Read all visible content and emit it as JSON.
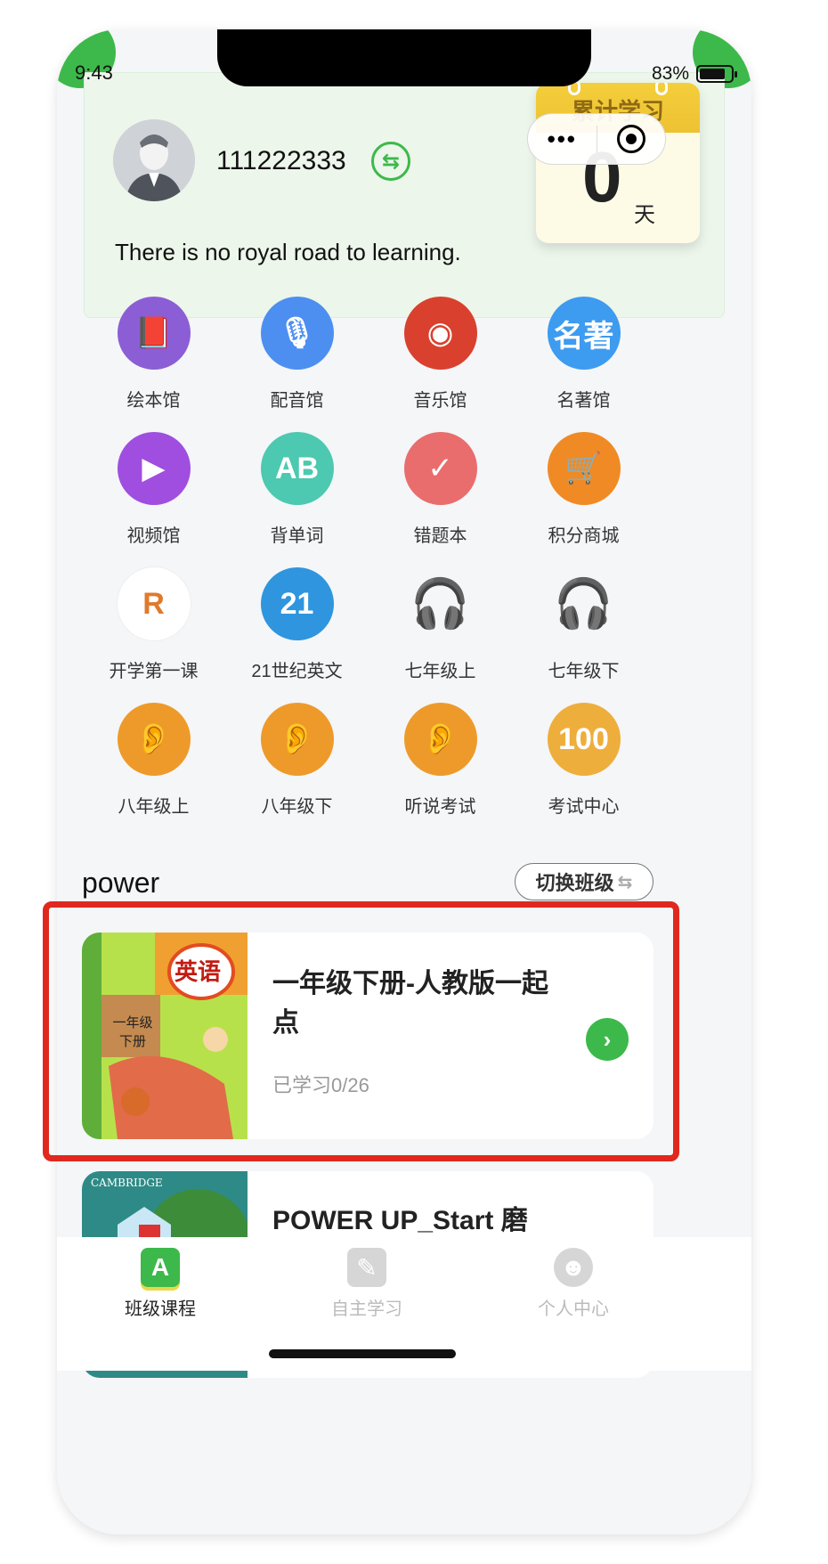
{
  "status_bar": {
    "time": "9:43",
    "battery": "83%",
    "battery_level": 0.83
  },
  "mini_program_capsule": {
    "more_label": "•••"
  },
  "profile": {
    "username": "111222333",
    "switch_icon": "⇆",
    "motto": "There is no royal road to learning."
  },
  "study_calendar": {
    "title": "累计学习",
    "days": "0",
    "unit": "天"
  },
  "features": [
    {
      "label": "绘本馆",
      "icon": "book-icon",
      "color": "#8b5ed6",
      "glyph": "📕"
    },
    {
      "label": "配音馆",
      "icon": "microphone-icon",
      "color": "#4d8ff0",
      "glyph": "🎙"
    },
    {
      "label": "音乐馆",
      "icon": "music-disc-icon",
      "color": "#d9412e",
      "glyph": "◉"
    },
    {
      "label": "名著馆",
      "icon": "classics-book-icon",
      "color": "#3d9bf0",
      "glyph": "名著"
    },
    {
      "label": "视频馆",
      "icon": "video-camera-icon",
      "color": "#a04ee0",
      "glyph": "▶"
    },
    {
      "label": "背单词",
      "icon": "abcd-icon",
      "color": "#4cc9b0",
      "glyph": "AB"
    },
    {
      "label": "错题本",
      "icon": "notebook-check-icon",
      "color": "#e96d6d",
      "glyph": "✓"
    },
    {
      "label": "积分商城",
      "icon": "shopping-cart-icon",
      "color": "#f08a24",
      "glyph": "🛒"
    },
    {
      "label": "开学第一课",
      "icon": "r-logo-icon",
      "color": "#ffffff",
      "glyph": "R"
    },
    {
      "label": "21世纪英文",
      "icon": "21-century-icon",
      "color": "#2f95de",
      "glyph": "21"
    },
    {
      "label": "七年级上",
      "icon": "headphones-icon",
      "color": "transparent",
      "glyph": "🎧"
    },
    {
      "label": "七年级下",
      "icon": "headphones-icon",
      "color": "transparent",
      "glyph": "🎧"
    },
    {
      "label": "八年级上",
      "icon": "speaking-head-icon",
      "color": "#ee9a2a",
      "glyph": "👂"
    },
    {
      "label": "八年级下",
      "icon": "speaking-head-icon",
      "color": "#ee9a2a",
      "glyph": "👂"
    },
    {
      "label": "听说考试",
      "icon": "speaking-head-icon",
      "color": "#ee9a2a",
      "glyph": "👂"
    },
    {
      "label": "考试中心",
      "icon": "exam-center-icon",
      "color": "#eeae3c",
      "glyph": "100"
    }
  ],
  "class_section": {
    "title": "power",
    "switch_label": "切换班级",
    "switch_icon": "⇆"
  },
  "courses": [
    {
      "title": "一年级下册-人教版一起点",
      "progress": "已学习0/26",
      "go_icon": "›",
      "cover_text": "英语",
      "cover_sub": "一年级\n下册"
    },
    {
      "title": "POWER UP_Start 磨",
      "cover_text": "CAMBRIDGE"
    }
  ],
  "tabs": [
    {
      "label": "班级课程",
      "icon": "class-course-icon",
      "glyph": "A",
      "active": true
    },
    {
      "label": "自主学习",
      "icon": "self-study-icon",
      "glyph": "✎",
      "active": false
    },
    {
      "label": "个人中心",
      "icon": "profile-icon",
      "glyph": "☻",
      "active": false
    }
  ]
}
